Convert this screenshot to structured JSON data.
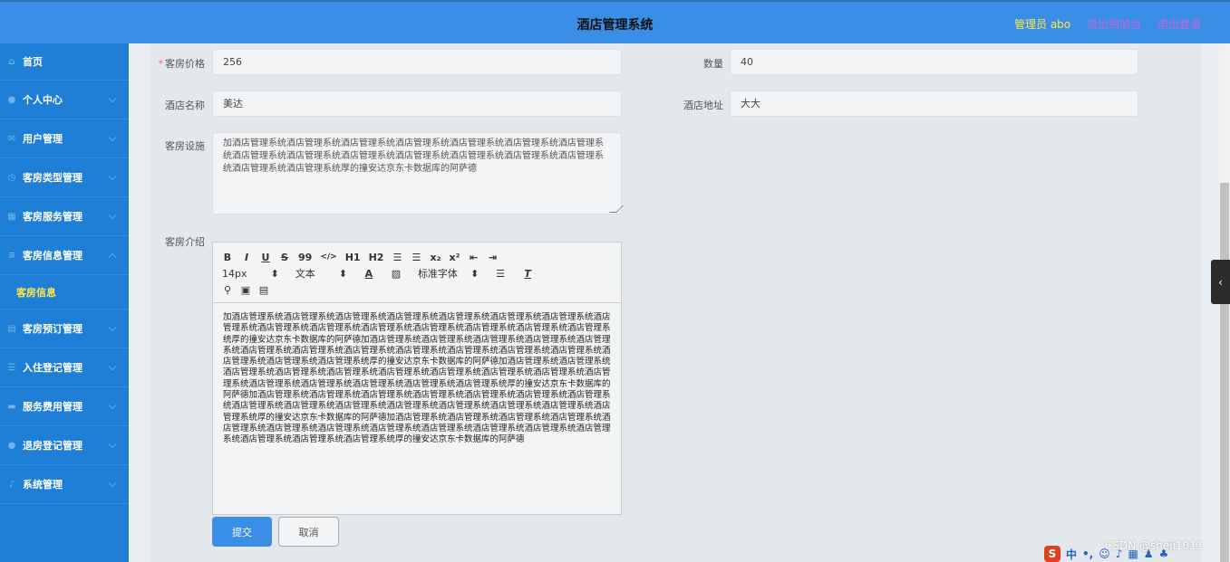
{
  "header": {
    "title": "酒店管理系统",
    "user": "管理员 abo",
    "to_front": "退出到前台",
    "logout": "退出登录"
  },
  "sidebar": {
    "items": [
      {
        "label": "首页",
        "icon": "home-icon"
      },
      {
        "label": "个人中心",
        "icon": "user-icon"
      },
      {
        "label": "用户管理",
        "icon": "mail-icon"
      },
      {
        "label": "客房类型管理",
        "icon": "clock-icon"
      },
      {
        "label": "客房服务管理",
        "icon": "grid-icon"
      },
      {
        "label": "客房信息管理",
        "icon": "list-icon"
      },
      {
        "label": "客房预订管理",
        "icon": "calendar-icon"
      },
      {
        "label": "入住登记管理",
        "icon": "list-icon"
      },
      {
        "label": "服务费用管理",
        "icon": "card-icon"
      },
      {
        "label": "退房登记管理",
        "icon": "pin-icon"
      },
      {
        "label": "系统管理",
        "icon": "mic-icon"
      }
    ],
    "active_sub": "客房信息"
  },
  "form": {
    "price_label": "客房价格",
    "price_value": "256",
    "qty_label": "数量",
    "qty_value": "40",
    "hotel_name_label": "酒店名称",
    "hotel_name_value": "美达",
    "hotel_addr_label": "酒店地址",
    "hotel_addr_value": "大大",
    "facility_label": "客房设施",
    "facility_value": "加酒店管理系统酒店管理系统酒店管理系统酒店管理系统酒店管理系统酒店管理系统酒店管理系统酒店管理系统酒店管理系统酒店管理系统酒店管理系统酒店管理系统酒店管理系统酒店管理系统酒店管理系统酒店管理系统厚的撞安达京东卡数据库的阿萨德",
    "intro_label": "客房介绍",
    "intro_value": "加酒店管理系统酒店管理系统酒店管理系统酒店管理系统酒店管理系统酒店管理系统酒店管理系统酒店管理系统酒店管理系统酒店管理系统酒店管理系统酒店管理系统酒店管理系统酒店管理系统酒店管理系统厚的撞安达京东卡数据库的阿萨德加酒店管理系统酒店管理系统酒店管理系统酒店管理系统酒店管理系统酒店管理系统酒店管理系统酒店管理系统酒店管理系统酒店管理系统酒店管理系统酒店管理系统酒店管理系统酒店管理系统酒店管理系统厚的撞安达京东卡数据库的阿萨德加酒店管理系统酒店管理系统酒店管理系统酒店管理系统酒店管理系统酒店管理系统酒店管理系统酒店管理系统酒店管理系统酒店管理系统酒店管理系统酒店管理系统酒店管理系统酒店管理系统酒店管理系统厚的撞安达京东卡数据库的阿萨德加酒店管理系统酒店管理系统酒店管理系统酒店管理系统酒店管理系统酒店管理系统酒店管理系统酒店管理系统酒店管理系统酒店管理系统酒店管理系统酒店管理系统酒店管理系统酒店管理系统酒店管理系统厚的撞安达京东卡数据库的阿萨德加酒店管理系统酒店管理系统酒店管理系统酒店管理系统酒店管理系统酒店管理系统酒店管理系统酒店管理系统酒店管理系统酒店管理系统酒店管理系统酒店管理系统酒店管理系统酒店管理系统酒店管理系统厚的撞安达京东卡数据库的阿萨德"
  },
  "editor_toolbar": {
    "row1": [
      "B",
      "I",
      "U",
      "S",
      "99",
      "</>",
      "H1",
      "H2",
      "☰",
      "☰",
      "x₂",
      "x²",
      "⇤",
      "⇥"
    ],
    "font_size": "14px",
    "header_select": "文本",
    "font_select": "标准字体",
    "color": "A"
  },
  "buttons": {
    "submit": "提交",
    "cancel": "取消"
  },
  "watermark": "CSDN @sheji1011"
}
